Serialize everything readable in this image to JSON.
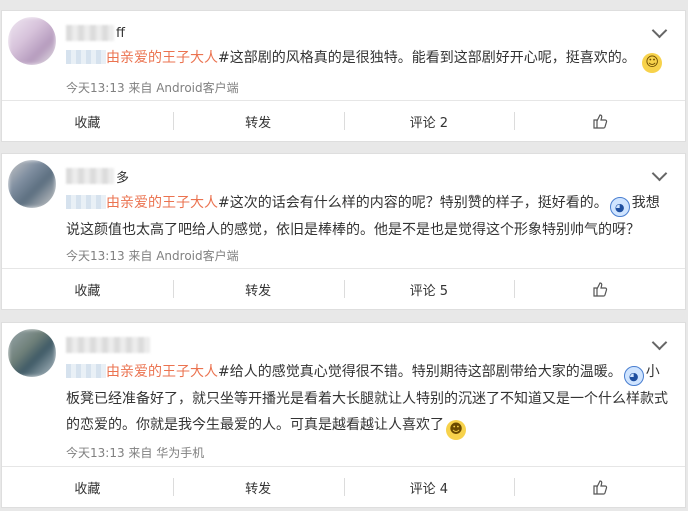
{
  "posts": [
    {
      "username": "ff",
      "topic": "由亲爱的王子大人",
      "content_before": "#这部剧的风格真的是很独特。能看到这部剧好开心呢，挺喜欢的。",
      "content_after": "",
      "emoji_1": "smile",
      "emoji_2": "",
      "meta": "今天13:13 来自 Android客户端",
      "actions": {
        "favorite": "收藏",
        "repost": "转发",
        "comment": "评论 2"
      }
    },
    {
      "username": "多",
      "topic": "由亲爱的王子大人",
      "content_before": "#这次的话会有什么样的内容的呢？特别赞的样子，挺好看的。",
      "content_after": "我想说这颜值也太高了吧给人的感觉，依旧是棒棒的。他是不是也是觉得这个形象特别帅气的呀？",
      "emoji_1": "doraemon",
      "emoji_2": "",
      "meta": "今天13:13 来自 Android客户端",
      "actions": {
        "favorite": "收藏",
        "repost": "转发",
        "comment": "评论 5"
      }
    },
    {
      "username": "",
      "topic": "由亲爱的王子大人",
      "content_before": "#给人的感觉真心觉得很不错。特别期待这部剧带给大家的温暖。",
      "content_after": "小板凳已经准备好了，就只坐等开播光是看着大长腿就让人特别的沉迷了不知道又是一个什么样款式的恋爱的。你就是我今生最爱的人。可真是越看越让人喜欢了",
      "emoji_1": "doraemon",
      "emoji_2": "grin",
      "meta": "今天13:13 来自 华为手机",
      "actions": {
        "favorite": "收藏",
        "repost": "转发",
        "comment": "评论 4"
      }
    }
  ],
  "icons": {
    "like": "thumbs-up-icon",
    "expand": "chevron-down-icon"
  },
  "colors": {
    "topic": "#eb7350",
    "meta": "#808080"
  }
}
